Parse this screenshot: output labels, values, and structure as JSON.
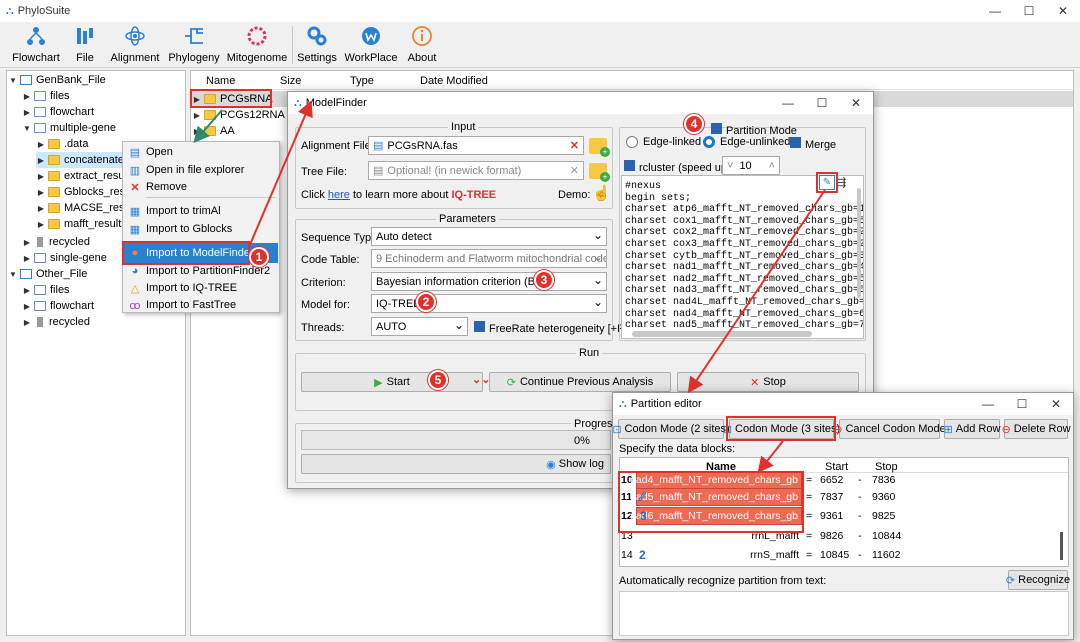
{
  "app": {
    "title": "PhyloSuite"
  },
  "toolbar": {
    "items": [
      {
        "label": "Flowchart",
        "icon": "flowchart-icon"
      },
      {
        "label": "File",
        "icon": "file-icon"
      },
      {
        "label": "Alignment",
        "icon": "alignment-icon"
      },
      {
        "label": "Phylogeny",
        "icon": "phylogeny-icon"
      },
      {
        "label": "Mitogenome",
        "icon": "mitogenome-icon"
      },
      {
        "label": "Settings",
        "icon": "settings-icon"
      },
      {
        "label": "WorkPlace",
        "icon": "workplace-icon"
      },
      {
        "label": "About",
        "icon": "about-icon"
      }
    ]
  },
  "tree": {
    "genbank": "GenBank_File",
    "files": "files",
    "flowchart": "flowchart",
    "multiple_gene": "multiple-gene",
    "data": ".data",
    "concatenate": "concatenate_",
    "extract": "extract_result",
    "gblocks": "Gblocks_resu",
    "macse": "MACSE_result",
    "mafft": "mafft_results",
    "recycled": "recycled",
    "single_gene": "single-gene",
    "other": "Other_File",
    "o_files": "files",
    "o_flowchart": "flowchart",
    "o_recycled": "recycled"
  },
  "filelist": {
    "headers": [
      "Name",
      "Size",
      "Type",
      "Date Modified"
    ],
    "rows": [
      "PCGsRNA",
      "PCGs12RNA",
      "AA"
    ]
  },
  "context_menu": {
    "items": [
      "Open",
      "Open in file explorer",
      "Remove",
      "Import to trimAl",
      "Import to Gblocks",
      "Import to ModelFinder",
      "Import to PartitionFinder2",
      "Import to IQ-TREE",
      "Import to FastTree"
    ]
  },
  "modelfinder": {
    "title": "ModelFinder",
    "input_title": "Input",
    "alignment_label": "Alignment File:",
    "alignment_value": "PCGsRNA.fas",
    "tree_label": "Tree File:",
    "tree_placeholder": "Optional! (in newick format)",
    "click_pre": "Click",
    "here": "here",
    "learn": "to learn more about",
    "iqtree": "IQ-TREE",
    "demo": "Demo:",
    "params_title": "Parameters",
    "seq_label": "Sequence Type:",
    "seq_value": "Auto detect",
    "code_label": "Code Table:",
    "code_value": "9 Echinoderm and Flatworm mitochondrial code",
    "crit_label": "Criterion:",
    "crit_value": "Bayesian information criterion (BIC)",
    "model_label": "Model for:",
    "model_value": "IQ-TREE",
    "threads_label": "Threads:",
    "threads_value": "AUTO",
    "freerate": "FreeRate heterogeneity [+R]",
    "run_title": "Run",
    "start": "Start",
    "continue": "Continue Previous Analysis",
    "stop": "Stop",
    "progress_title": "Progress",
    "progress_value": "0%",
    "show_log": "Show log",
    "partition_mode": "Partition Mode",
    "edge_linked": "Edge-linked",
    "edge_unlinked": "Edge-unlinked",
    "merge": "Merge",
    "rcluster": "rcluster (speed up):",
    "rcluster_value": "10",
    "nexus": "#nexus\nbegin sets;\ncharset atp6_mafft_NT_removed_chars_gb=1-\ncharset cox1_mafft_NT_removed_chars_gb=5:\ncharset cox2_mafft_NT_removed_chars_gb=2(\ncharset cox3_mafft_NT_removed_chars_gb=2(\ncharset cytb_mafft_NT_removed_chars_gb=3:\ncharset nad1_mafft_NT_removed_chars_gb=4:\ncharset nad2_mafft_NT_removed_chars_gb=5:\ncharset nad3_mafft_NT_removed_chars_gb=6(\ncharset nad4L_mafft_NT_removed_chars_gb=(\ncharset nad4_mafft_NT_removed_chars_gb=6(\ncharset nad5_mafft_NT_removed_chars_gb=7("
  },
  "partition_editor": {
    "title": "Partition editor",
    "codon2": "Codon Mode (2 sites)",
    "codon3": "Codon Mode (3 sites)",
    "cancel": "Cancel Codon Mode",
    "add_row": "Add Row",
    "delete_row": "Delete Row",
    "specify": "Specify the data blocks:",
    "col_name": "Name",
    "col_start": "Start",
    "col_stop": "Stop",
    "rows": [
      {
        "idx": "10",
        "mark": "",
        "name": "nad4_mafft_NT_removed_chars_gb",
        "eq": "=",
        "start": "6652",
        "dash": "-",
        "stop": "7836"
      },
      {
        "idx": "11",
        "mark": "⁄⁄",
        "name": "nad5_mafft_NT_removed_chars_gb",
        "eq": "=",
        "start": "7837",
        "dash": "-",
        "stop": "9360"
      },
      {
        "idx": "12",
        "mark": "3",
        "name": "nad6_mafft_NT_removed_chars_gb",
        "eq": "=",
        "start": "9361",
        "dash": "-",
        "stop": "9825"
      },
      {
        "idx": "13",
        "mark": "",
        "name": "rrnL_mafft",
        "eq": "=",
        "start": "9826",
        "dash": "-",
        "stop": "10844"
      },
      {
        "idx": "14",
        "mark": "2",
        "name": "rrnS_mafft",
        "eq": "=",
        "start": "10845",
        "dash": "-",
        "stop": "11602"
      }
    ],
    "auto_recognize": "Automatically recognize partition from text:",
    "recognize": "Recognize"
  },
  "badges": [
    "1",
    "2",
    "3",
    "4",
    "5"
  ],
  "colors": {
    "accent": "#e0302a",
    "selection": "#cce8ff",
    "highlight_row": "#ef6a55"
  }
}
